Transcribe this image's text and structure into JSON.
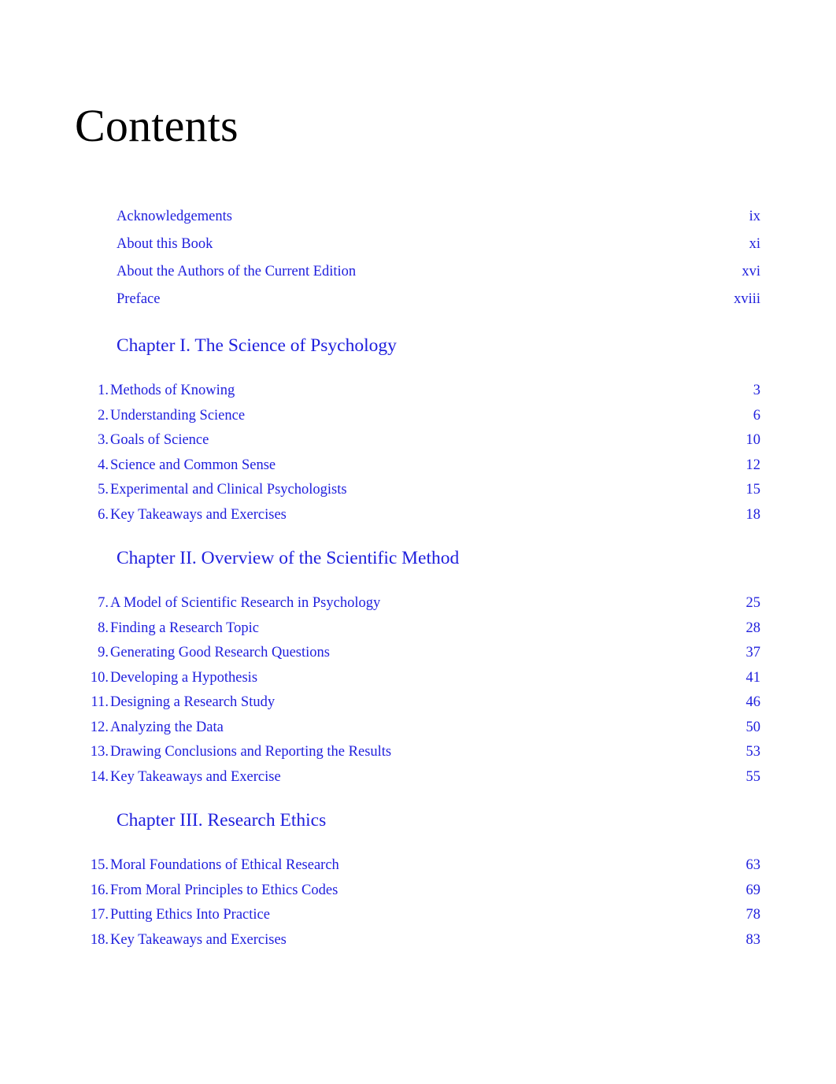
{
  "document": {
    "title": "Contents",
    "text_color_link": "#2020dd",
    "text_color_title": "#000000",
    "background": "#ffffff"
  },
  "front_matter": [
    {
      "label": "Acknowledgements",
      "page": "ix"
    },
    {
      "label": "About this Book",
      "page": "xi"
    },
    {
      "label": "About the Authors of the Current Edition",
      "page": "xvi"
    },
    {
      "label": "Preface",
      "page": "xviii"
    }
  ],
  "chapters": [
    {
      "heading": "Chapter I. The Science of Psychology",
      "items": [
        {
          "index": "1.",
          "label": "Methods of Knowing",
          "page": "3"
        },
        {
          "index": "2.",
          "label": "Understanding Science",
          "page": "6"
        },
        {
          "index": "3.",
          "label": "Goals of Science",
          "page": "10"
        },
        {
          "index": "4.",
          "label": "Science and Common Sense",
          "page": "12"
        },
        {
          "index": "5.",
          "label": "Experimental and Clinical Psychologists",
          "page": "15"
        },
        {
          "index": "6.",
          "label": "Key Takeaways and Exercises",
          "page": "18"
        }
      ]
    },
    {
      "heading": "Chapter II. Overview of the Scientific Method",
      "items": [
        {
          "index": "7.",
          "label": "A Model of Scientific Research in Psychology",
          "page": "25"
        },
        {
          "index": "8.",
          "label": "Finding a Research Topic",
          "page": "28"
        },
        {
          "index": "9.",
          "label": "Generating Good Research Questions",
          "page": "37"
        },
        {
          "index": "10.",
          "label": "Developing a Hypothesis",
          "page": "41"
        },
        {
          "index": "11.",
          "label": "Designing a Research Study",
          "page": "46"
        },
        {
          "index": "12.",
          "label": "Analyzing the Data",
          "page": "50"
        },
        {
          "index": "13.",
          "label": "Drawing Conclusions and Reporting the Results",
          "page": "53"
        },
        {
          "index": "14.",
          "label": "Key Takeaways and Exercise",
          "page": "55"
        }
      ]
    },
    {
      "heading": "Chapter III. Research Ethics",
      "items": [
        {
          "index": "15.",
          "label": "Moral Foundations of Ethical Research",
          "page": "63"
        },
        {
          "index": "16.",
          "label": "From Moral Principles to Ethics Codes",
          "page": "69"
        },
        {
          "index": "17.",
          "label": "Putting Ethics Into Practice",
          "page": "78"
        },
        {
          "index": "18.",
          "label": "Key Takeaways and Exercises",
          "page": "83"
        }
      ]
    }
  ]
}
